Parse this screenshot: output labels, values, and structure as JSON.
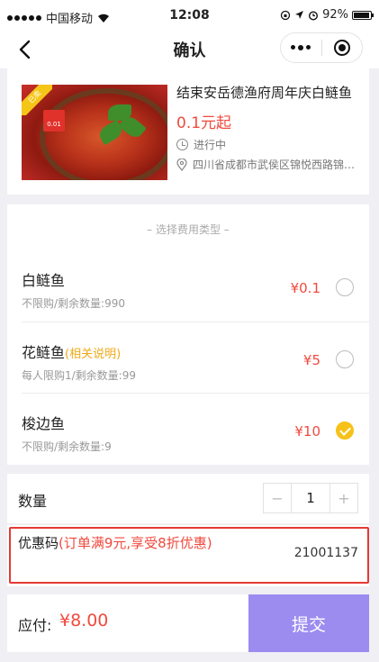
{
  "status_bar": {
    "carrier": "中国移动",
    "time": "12:08",
    "battery": "92%"
  },
  "nav": {
    "title": "确认"
  },
  "product": {
    "badge": "已卖",
    "tag": "0.01",
    "title": "结束安岳德渔府周年庆白鲢鱼",
    "price": "0.1元起",
    "status": "进行中",
    "address": "四川省成都市武侯区锦悦西路锦悦西路"
  },
  "fee_types": {
    "heading": "– 选择费用类型 –",
    "options": [
      {
        "name": "白鲢鱼",
        "hint": "",
        "sub": "不限购/剩余数量:990",
        "price": "¥0.1",
        "selected": false
      },
      {
        "name": "花鲢鱼",
        "hint": "(相关说明)",
        "sub": "每人限购1/剩余数量:99",
        "price": "¥5",
        "selected": false
      },
      {
        "name": "梭边鱼",
        "hint": "",
        "sub": "不限购/剩余数量:9",
        "price": "¥10",
        "selected": true
      }
    ]
  },
  "quantity": {
    "label": "数量",
    "minus": "−",
    "value": "1",
    "plus": "+"
  },
  "coupon": {
    "label": "优惠码",
    "note": "(订单满9元,享受8折优惠)",
    "code": "21001137"
  },
  "footer": {
    "label": "应付:",
    "amount": "¥8.00",
    "submit": "提交"
  },
  "colors": {
    "accent_red": "#f04a3e",
    "selected_yellow": "#f6c21a",
    "submit_purple": "#9c8cf0",
    "hint_orange": "#f0a818"
  }
}
